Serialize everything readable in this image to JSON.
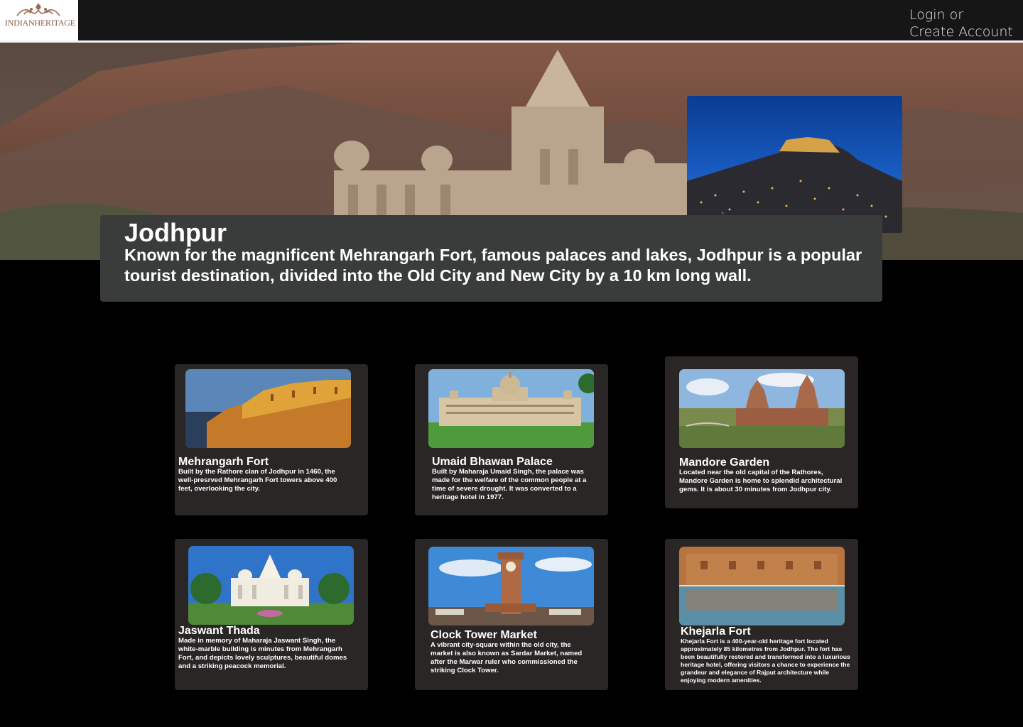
{
  "header": {
    "logo_text": "INDIANHERITAGE",
    "login_label": "Login or",
    "create_account_label": "Create Account"
  },
  "intro": {
    "title": "Jodhpur",
    "description": "Known for the magnificent Mehrangarh Fort, famous palaces and lakes, Jodhpur is a popular tourist destination, divided into the Old City and New City by a 10 km long wall."
  },
  "places": [
    {
      "title": "Mehrangarh Fort",
      "description": "Built by the Rathore clan of Jodhpur in 1460, the well-presrved Mehrangarh Fort towers above 400 feet, overlooking the city."
    },
    {
      "title": "Umaid Bhawan Palace",
      "description": "Built by Maharaja Umaid Singh, the palace was made for the welfare of the common people at a time of severe drought. It was converted to a heritage hotel in 1977."
    },
    {
      "title": "Mandore Garden",
      "description": "Located near the old capital of the Rathores, Mandore Garden is home to splendid architectural gems. It is about 30 minutes from Jodhpur city."
    },
    {
      "title": "Jaswant Thada",
      "description": "Made in memory of Maharaja Jaswant Singh, the white-marble building is minutes from Mehrangarh Fort, and depicts lovely sculptures, beautiful domes and a striking peacock memorial."
    },
    {
      "title": "Clock Tower Market",
      "description": "A vibrant city-square within the old city, the market is also known as Sardar Market, named after the Marwar ruler who commissioned the striking Clock Tower."
    },
    {
      "title": "Khejarla Fort",
      "description": "Khejarla Fort is a 400-year-old heritage fort located approximately 85 kilometres from Jodhpur. The fort has been beautifully restored and transformed into a luxurious heritage hotel, offering visitors a chance to experience the grandeur and elegance of Rajput architecture while enjoying modern amenities."
    }
  ],
  "colors": {
    "topbar": "#161616",
    "card_bg": "#2a2626",
    "intro_bg": "#3a3c3c",
    "logo_brown": "#8a5a43"
  }
}
